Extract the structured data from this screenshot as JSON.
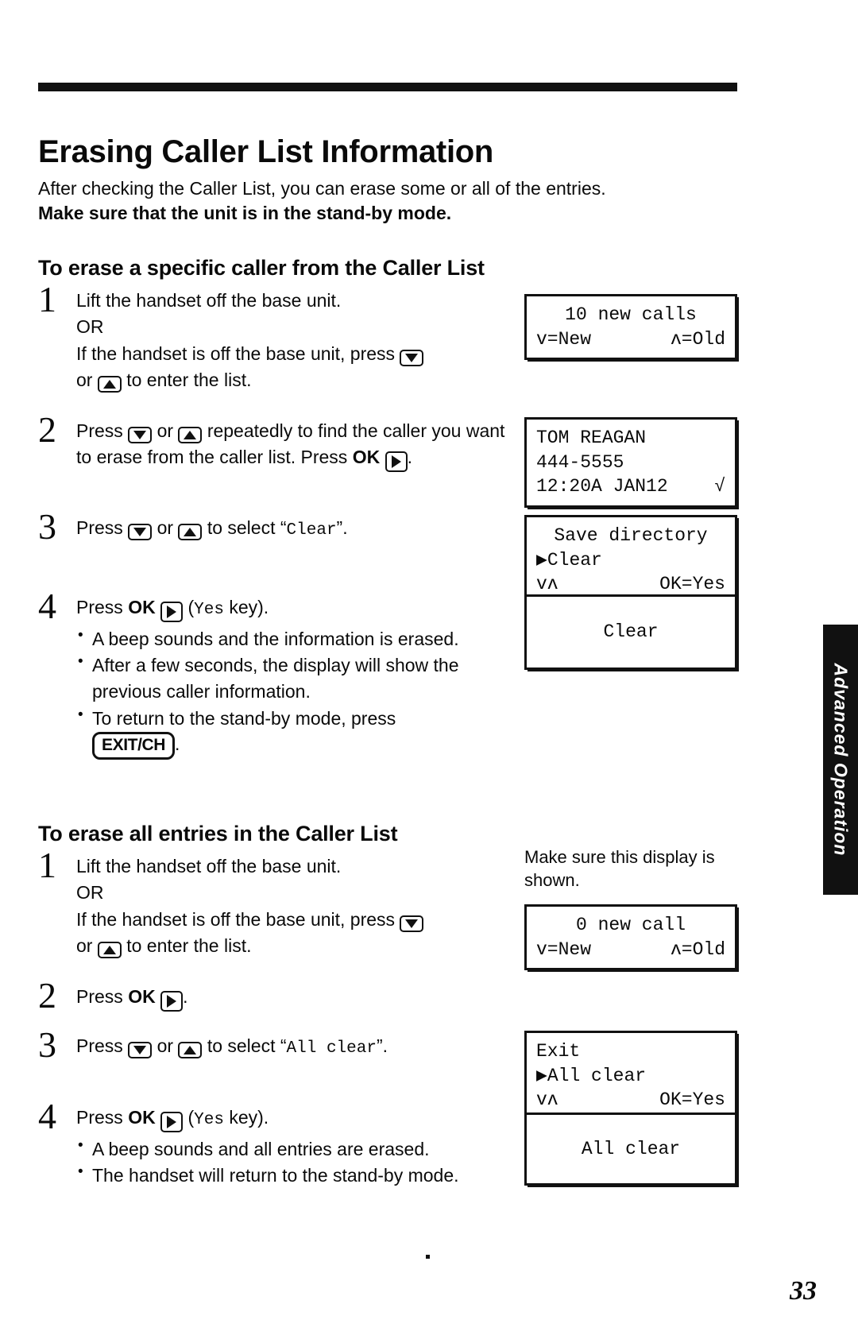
{
  "page_title": "Erasing Caller List Information",
  "intro": {
    "line1": "After checking the Caller List, you can erase some or all of the entries.",
    "line2": "Make sure that the unit is in the stand-by mode."
  },
  "sections": [
    {
      "heading": "To erase a specific caller from the Caller List",
      "steps": [
        {
          "number": "1",
          "text_a": "Lift the handset off the base unit.",
          "text_b": "OR",
          "text_c": "If the handset is off the base unit, press",
          "text_d": "or",
          "text_e": "to enter the list."
        },
        {
          "number": "2",
          "text_a": "Press",
          "text_b": "or",
          "text_c": "repeatedly to find the caller you want to erase from the caller list. Press",
          "text_d": "OK",
          "text_e": "."
        },
        {
          "number": "3",
          "text_a": "Press",
          "text_b": "or",
          "text_c": "to select",
          "quoted": "Clear",
          "text_d": "."
        },
        {
          "number": "4",
          "text_a": "Press",
          "text_b": "OK",
          "text_c": "(",
          "quoted": "Yes",
          "text_d": "key).",
          "bullets": [
            "A beep sounds and the information is erased.",
            "After a few seconds, the display will show the previous caller information.",
            "To return to the stand-by mode, press"
          ],
          "bullet3_key": "EXIT/CH",
          "bullet3_tail": "."
        }
      ]
    },
    {
      "heading": "To erase all entries in the Caller List",
      "steps": [
        {
          "number": "1",
          "text_a": "Lift the handset off the base unit.",
          "text_b": "OR",
          "text_c": "If the handset is off the base unit, press",
          "text_d": "or",
          "text_e": "to enter the list."
        },
        {
          "number": "2",
          "text_a": "Press",
          "text_b": "OK",
          "text_c": "."
        },
        {
          "number": "3",
          "text_a": "Press",
          "text_b": "or",
          "text_c": "to select",
          "quoted": "All clear",
          "text_d": "."
        },
        {
          "number": "4",
          "text_a": "Press",
          "text_b": "OK",
          "text_c": "(",
          "quoted": "Yes",
          "text_d": "key).",
          "bullets": [
            "A beep sounds and all entries are erased.",
            "The handset will return to the stand-by mode."
          ]
        }
      ]
    }
  ],
  "note": {
    "make_sure": "Make sure this display is shown."
  },
  "displays": [
    {
      "id": "display-new-calls",
      "line1": "10 new calls",
      "line2_left": "v=New",
      "line2_right": "ʌ=Old"
    },
    {
      "id": "display-caller-entry",
      "line1": "TOM REAGAN",
      "line2": "444-5555",
      "line3_left": "12:20A JAN12",
      "line3_right": "√"
    },
    {
      "id": "display-clear-menu",
      "line1": "Save directory",
      "line2": "▶Clear",
      "line3_left": "vʌ",
      "line3_right": "OK=Yes"
    },
    {
      "id": "display-clear-confirm",
      "line1": "Clear"
    },
    {
      "id": "display-zero-calls",
      "line1": "0 new call",
      "line2_left": "v=New",
      "line2_right": "ʌ=Old"
    },
    {
      "id": "display-all-clear-menu",
      "line1": "Exit",
      "line2": "▶All clear",
      "line3_left": "vʌ",
      "line3_right": "OK=Yes"
    },
    {
      "id": "display-all-clear-confirm",
      "line1": "All clear"
    }
  ],
  "side_tab_label": "Advanced Operation",
  "page_number": "33",
  "colors": {
    "ink": "#111111",
    "paper": "#ffffff"
  }
}
